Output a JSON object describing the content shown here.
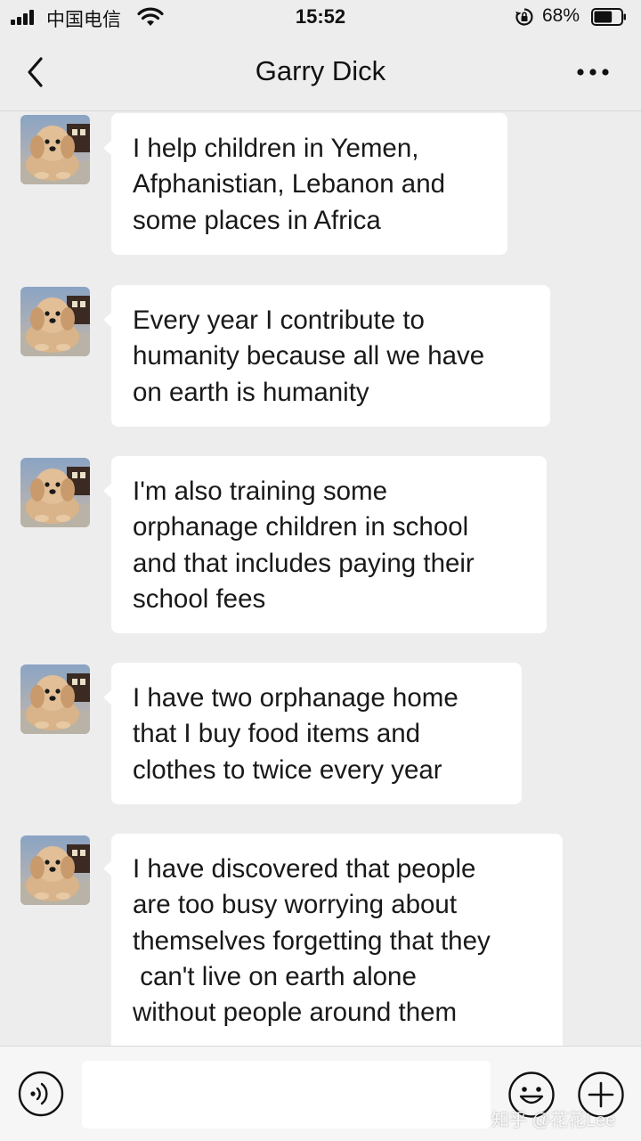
{
  "status_bar": {
    "carrier": "中国电信",
    "time": "15:52",
    "battery_percent": "68%",
    "battery_level": 0.68,
    "icons": [
      "signal-icon",
      "wifi-icon",
      "orientation-lock-icon",
      "battery-icon"
    ]
  },
  "nav": {
    "title": "Garry Dick",
    "back_icon": "chevron-left-icon",
    "more_icon": "more-dots-icon"
  },
  "messages": [
    {
      "sender": "Garry Dick",
      "text": "I help children in Yemen,\nAfphanistian, Lebanon and\nsome places in Africa"
    },
    {
      "sender": "Garry Dick",
      "text": "Every year I contribute to\nhumanity because all we have\non earth is humanity"
    },
    {
      "sender": "Garry Dick",
      "text": "I'm also training some\norphanage children in school\nand that includes paying their\nschool fees"
    },
    {
      "sender": "Garry Dick",
      "text": "I have two orphanage home\nthat I buy food items and\nclothes to twice every year"
    },
    {
      "sender": "Garry Dick",
      "text": "I have discovered that people\nare too busy worrying about\nthemselves forgetting that they\n can't live on earth alone\nwithout people around them"
    }
  ],
  "input_bar": {
    "value": "",
    "voice_icon": "voice-input-icon",
    "emoji_icon": "emoji-icon",
    "plus_icon": "plus-icon"
  },
  "watermark": "知乎 @花花Lee",
  "colors": {
    "background": "#ededed",
    "bubble": "#ffffff",
    "text": "#191919"
  }
}
